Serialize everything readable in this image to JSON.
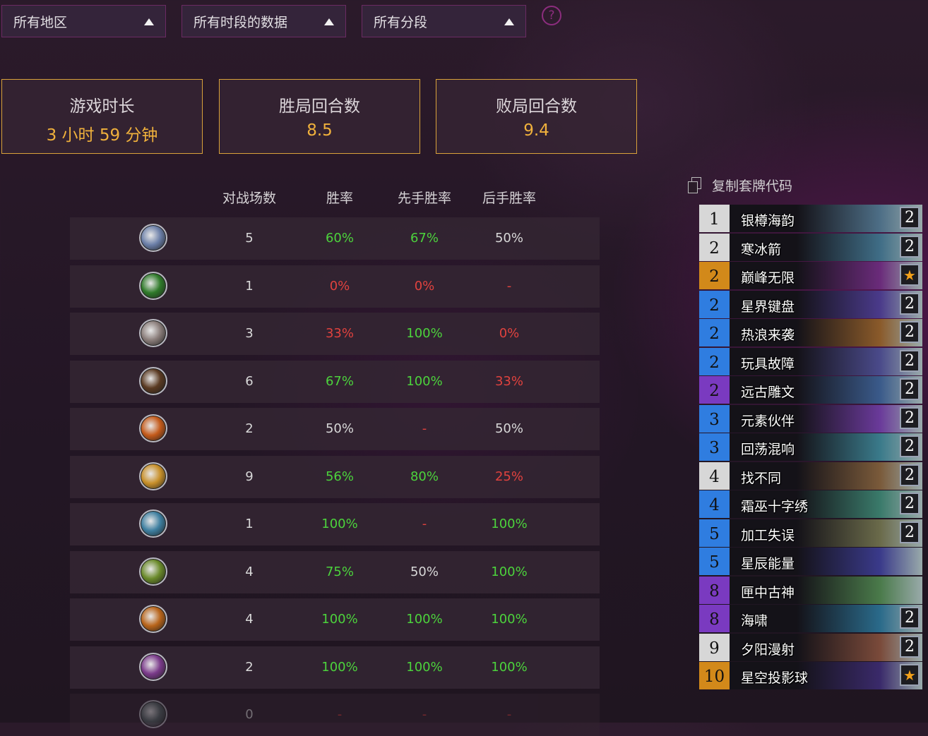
{
  "filters": {
    "region": "所有地区",
    "time": "所有时段的数据",
    "rank": "所有分段",
    "help": "?"
  },
  "stats": {
    "duration": {
      "label": "游戏时长",
      "value": "3 小时 59 分钟"
    },
    "win_turns": {
      "label": "胜局回合数",
      "value": "8.5"
    },
    "loss_turns": {
      "label": "败局回合数",
      "value": "9.4"
    }
  },
  "matchup_table": {
    "headers": [
      "对战场数",
      "胜率",
      "先手胜率",
      "后手胜率"
    ],
    "rows": [
      {
        "class_icon": "shaman-icon",
        "icon_color": "#6b7fa8",
        "games": "5",
        "winrate": "60%",
        "first": "67%",
        "second": "50%",
        "colors": [
          "white",
          "green",
          "green",
          "white"
        ]
      },
      {
        "class_icon": "rogue-icon",
        "icon_color": "#2f7a2a",
        "games": "1",
        "winrate": "0%",
        "first": "0%",
        "second": "-",
        "colors": [
          "white",
          "red",
          "red",
          "red"
        ]
      },
      {
        "class_icon": "warrior-icon",
        "icon_color": "#8a7d7a",
        "games": "3",
        "winrate": "33%",
        "first": "100%",
        "second": "0%",
        "colors": [
          "white",
          "red",
          "green",
          "red"
        ]
      },
      {
        "class_icon": "hunter-icon",
        "icon_color": "#5a3a22",
        "games": "6",
        "winrate": "67%",
        "first": "100%",
        "second": "33%",
        "colors": [
          "white",
          "green",
          "green",
          "red"
        ]
      },
      {
        "class_icon": "mage-icon",
        "icon_color": "#c45a1a",
        "games": "2",
        "winrate": "50%",
        "first": "-",
        "second": "50%",
        "colors": [
          "white",
          "white",
          "red",
          "white"
        ]
      },
      {
        "class_icon": "paladin-icon",
        "icon_color": "#c8902a",
        "games": "9",
        "winrate": "56%",
        "first": "80%",
        "second": "25%",
        "colors": [
          "white",
          "green",
          "green",
          "red"
        ]
      },
      {
        "class_icon": "death-knight-icon",
        "icon_color": "#3e7fa0",
        "games": "1",
        "winrate": "100%",
        "first": "-",
        "second": "100%",
        "colors": [
          "white",
          "green",
          "red",
          "green"
        ]
      },
      {
        "class_icon": "druid-icon",
        "icon_color": "#6a8a2a",
        "games": "4",
        "winrate": "75%",
        "first": "50%",
        "second": "100%",
        "colors": [
          "white",
          "green",
          "white",
          "green"
        ]
      },
      {
        "class_icon": "warlock-icon",
        "icon_color": "#b8641a",
        "games": "4",
        "winrate": "100%",
        "first": "100%",
        "second": "100%",
        "colors": [
          "white",
          "green",
          "green",
          "green"
        ]
      },
      {
        "class_icon": "priest-icon",
        "icon_color": "#7a3a8a",
        "games": "2",
        "winrate": "100%",
        "first": "100%",
        "second": "100%",
        "colors": [
          "white",
          "green",
          "green",
          "green"
        ]
      },
      {
        "class_icon": "demon-hunter-icon",
        "icon_color": "#5a6a6a",
        "games": "0",
        "winrate": "-",
        "first": "-",
        "second": "-",
        "colors": [
          "white",
          "red",
          "red",
          "red"
        ]
      }
    ]
  },
  "deck": {
    "copy_label": "复制套牌代码",
    "cards": [
      {
        "cost": "1",
        "name": "银樽海韵",
        "count": "2",
        "rarity_color": "#d7d7d7",
        "art_color": "#4d6e86"
      },
      {
        "cost": "2",
        "name": "寒冰箭",
        "count": "2",
        "rarity_color": "#d7d7d7",
        "art_color": "#3f6d86"
      },
      {
        "cost": "2",
        "name": "巅峰无限",
        "count": "★",
        "rarity_color": "#d2891a",
        "art_color": "#6a2b7a"
      },
      {
        "cost": "2",
        "name": "星界键盘",
        "count": "2",
        "rarity_color": "#2f7de0",
        "art_color": "#4a3a8a"
      },
      {
        "cost": "2",
        "name": "热浪来袭",
        "count": "2",
        "rarity_color": "#2f7de0",
        "art_color": "#8a5a2a"
      },
      {
        "cost": "2",
        "name": "玩具故障",
        "count": "2",
        "rarity_color": "#2f7de0",
        "art_color": "#4a4a8a"
      },
      {
        "cost": "2",
        "name": "远古雕文",
        "count": "2",
        "rarity_color": "#7a3ac0",
        "art_color": "#3a5a8a"
      },
      {
        "cost": "3",
        "name": "元素伙伴",
        "count": "2",
        "rarity_color": "#2f7de0",
        "art_color": "#6a3a9a"
      },
      {
        "cost": "3",
        "name": "回荡混响",
        "count": "2",
        "rarity_color": "#2f7de0",
        "art_color": "#3a7a8a"
      },
      {
        "cost": "4",
        "name": "找不同",
        "count": "2",
        "rarity_color": "#d7d7d7",
        "art_color": "#7a5a3a"
      },
      {
        "cost": "4",
        "name": "霜巫十字绣",
        "count": "2",
        "rarity_color": "#2f7de0",
        "art_color": "#3a7a6a"
      },
      {
        "cost": "5",
        "name": "加工失误",
        "count": "2",
        "rarity_color": "#2f7de0",
        "art_color": "#6a6a4a"
      },
      {
        "cost": "5",
        "name": "星辰能量",
        "count": "",
        "rarity_color": "#2f7de0",
        "art_color": "#3a3a8a"
      },
      {
        "cost": "8",
        "name": "匣中古神",
        "count": "",
        "rarity_color": "#7a3ac0",
        "art_color": "#4a7a4a"
      },
      {
        "cost": "8",
        "name": "海啸",
        "count": "2",
        "rarity_color": "#7a3ac0",
        "art_color": "#2a6a8a"
      },
      {
        "cost": "9",
        "name": "夕阳漫射",
        "count": "2",
        "rarity_color": "#d7d7d7",
        "art_color": "#7a4a3a"
      },
      {
        "cost": "10",
        "name": "星空投影球",
        "count": "★",
        "rarity_color": "#d2891a",
        "art_color": "#3a2a6a"
      }
    ]
  }
}
